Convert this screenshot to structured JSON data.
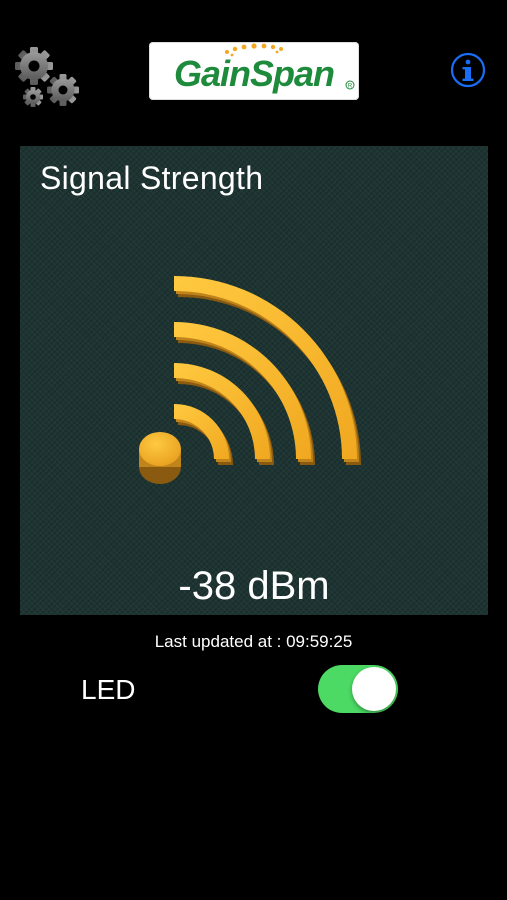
{
  "header": {
    "settings_icon": "gears-icon",
    "logo_text": "GainSpan",
    "info_icon": "info-icon"
  },
  "signal": {
    "title": "Signal Strength",
    "value": "-38 dBm",
    "icon": "wifi-signal-icon",
    "icon_color": "#f0b030"
  },
  "status": {
    "last_updated": "Last updated at : 09:59:25"
  },
  "led": {
    "label": "LED",
    "on": true,
    "toggle_color": "#4cd964"
  },
  "colors": {
    "background": "#000000",
    "panel": "#1d3432",
    "info_blue": "#1a6df5"
  }
}
